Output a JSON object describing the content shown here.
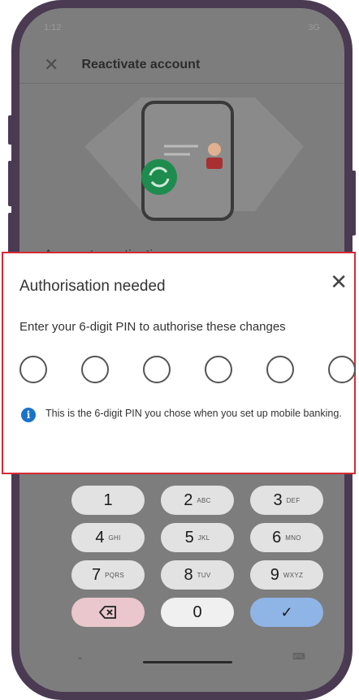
{
  "status_bar": {
    "time": "1:12",
    "network": "3G"
  },
  "top_bar": {
    "title": "Reactivate account"
  },
  "background": {
    "section_heading": "Account reactivation"
  },
  "dialog": {
    "title": "Authorisation needed",
    "subtitle": "Enter your 6-digit PIN to authorise these changes",
    "pin_length": 6,
    "info_text": "This is the 6-digit PIN you chose when you set up mobile banking."
  },
  "keypad": {
    "keys": [
      {
        "digit": "1",
        "letters": ""
      },
      {
        "digit": "2",
        "letters": "ABC"
      },
      {
        "digit": "3",
        "letters": "DEF"
      },
      {
        "digit": "4",
        "letters": "GHI"
      },
      {
        "digit": "5",
        "letters": "JKL"
      },
      {
        "digit": "6",
        "letters": "MNO"
      },
      {
        "digit": "7",
        "letters": "PQRS"
      },
      {
        "digit": "8",
        "letters": "TUV"
      },
      {
        "digit": "9",
        "letters": "WXYZ"
      }
    ],
    "zero": "0",
    "confirm_symbol": "✓"
  },
  "colors": {
    "highlight_border": "#d52b35",
    "info_icon": "#1b73c9",
    "confirm_key": "#8fb4e6",
    "delete_key": "#e9c7cd",
    "sync_badge": "#1e8c4e"
  },
  "icons": {
    "close": "close-icon",
    "info": "info-icon",
    "backspace": "backspace-icon",
    "sync": "sync-icon"
  }
}
